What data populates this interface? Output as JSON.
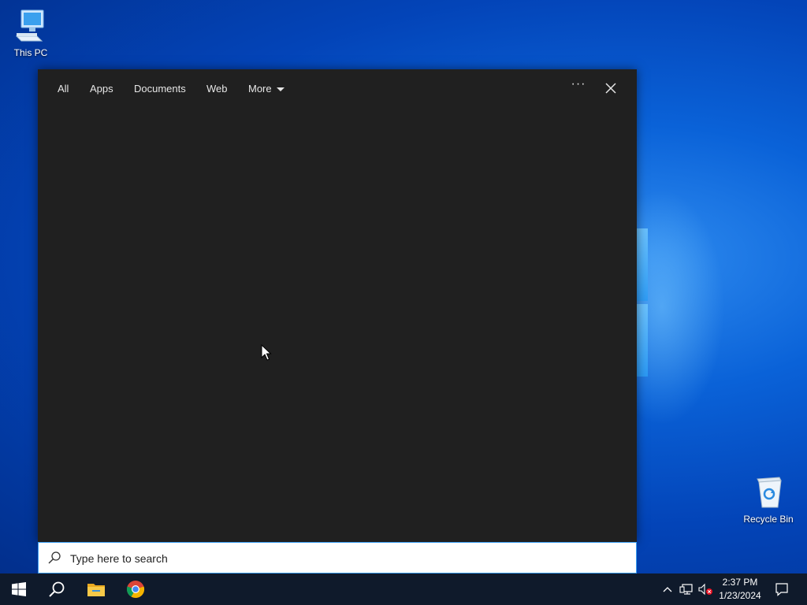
{
  "desktop": {
    "icons": [
      {
        "label": "This PC",
        "icon": "computer-icon"
      },
      {
        "label": "Recycle Bin",
        "icon": "recycle-bin-icon"
      }
    ]
  },
  "search": {
    "tabs": [
      {
        "label": "All"
      },
      {
        "label": "Apps"
      },
      {
        "label": "Documents"
      },
      {
        "label": "Web"
      },
      {
        "label": "More"
      }
    ],
    "more_options_glyph": "···",
    "placeholder": "Type here to search"
  },
  "taskbar": {
    "pinned": [
      {
        "name": "start",
        "icon": "windows-logo-icon"
      },
      {
        "name": "search",
        "icon": "search-icon"
      },
      {
        "name": "file-explorer",
        "icon": "folder-icon"
      },
      {
        "name": "chrome",
        "icon": "chrome-icon"
      }
    ],
    "tray": {
      "time": "2:37 PM",
      "date": "1/23/2024"
    }
  },
  "colors": {
    "panel_bg": "#202020",
    "taskbar_bg": "#0f1a2b",
    "search_border": "#3a9df2"
  }
}
